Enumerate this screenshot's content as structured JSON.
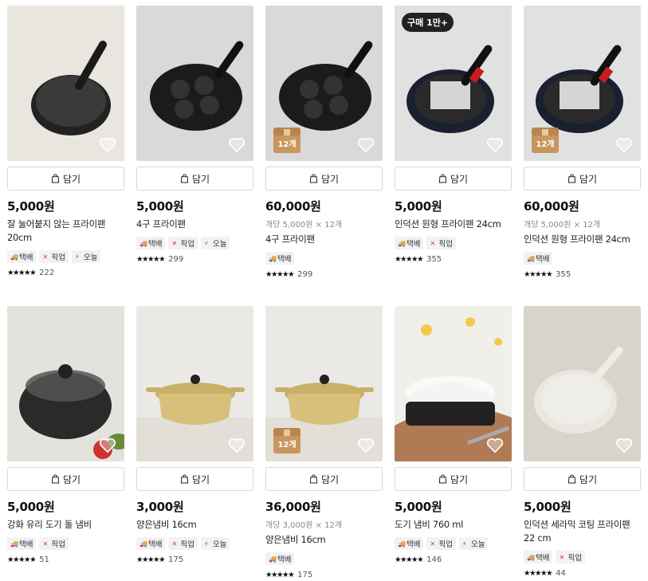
{
  "cart_label": "담기",
  "tag_labels": {
    "delivery": "택배",
    "pickup": "픽업",
    "today": "오늘"
  },
  "products": [
    {
      "price": "5,000원",
      "name": "잘 눌어붙지 않는 프라이팬 20cm",
      "tags": [
        "delivery",
        "pickup",
        "today"
      ],
      "rating_count": "222",
      "stars": "★★★★★"
    },
    {
      "price": "5,000원",
      "name": "4구 프라이팬",
      "tags": [
        "delivery",
        "pickup",
        "today"
      ],
      "rating_count": "299",
      "stars": "★★★★★"
    },
    {
      "price": "60,000원",
      "unit": "개당 5,000원 × 12개",
      "name": "4구 프라이팬",
      "tags": [
        "delivery"
      ],
      "rating_count": "299",
      "stars": "★★★★★",
      "box": "12개"
    },
    {
      "price": "5,000원",
      "name": "인덕션 원형 프라이팬 24cm",
      "tags": [
        "delivery",
        "pickup"
      ],
      "rating_count": "355",
      "stars": "★★★★★",
      "badge": "구매 1만+"
    },
    {
      "price": "60,000원",
      "unit": "개당 5,000원 × 12개",
      "name": "인덕션 원형 프라이팬 24cm",
      "tags": [
        "delivery"
      ],
      "rating_count": "355",
      "stars": "★★★★★",
      "box": "12개"
    },
    {
      "price": "5,000원",
      "name": "강화 유리 도기 돌 냄비",
      "tags": [
        "delivery",
        "pickup"
      ],
      "rating_count": "51",
      "stars": "★★★★★"
    },
    {
      "price": "3,000원",
      "name": "양은냄비 16cm",
      "tags": [
        "delivery",
        "pickup",
        "today"
      ],
      "rating_count": "175",
      "stars": "★★★★★"
    },
    {
      "price": "36,000원",
      "unit": "개당 3,000원 × 12개",
      "name": "양은냄비 16cm",
      "tags": [
        "delivery"
      ],
      "rating_count": "175",
      "stars": "★★★★★",
      "box": "12개"
    },
    {
      "price": "5,000원",
      "name": "도기 냄비 760 ml",
      "tags": [
        "delivery",
        "pickup",
        "today"
      ],
      "rating_count": "146",
      "stars": "★★★★★"
    },
    {
      "price": "5,000원",
      "name": "인덕션 세라믹 코팅 프라이팬 22 cm",
      "tags": [
        "delivery",
        "pickup"
      ],
      "rating_count": "44",
      "stars": "★★★★★"
    }
  ]
}
